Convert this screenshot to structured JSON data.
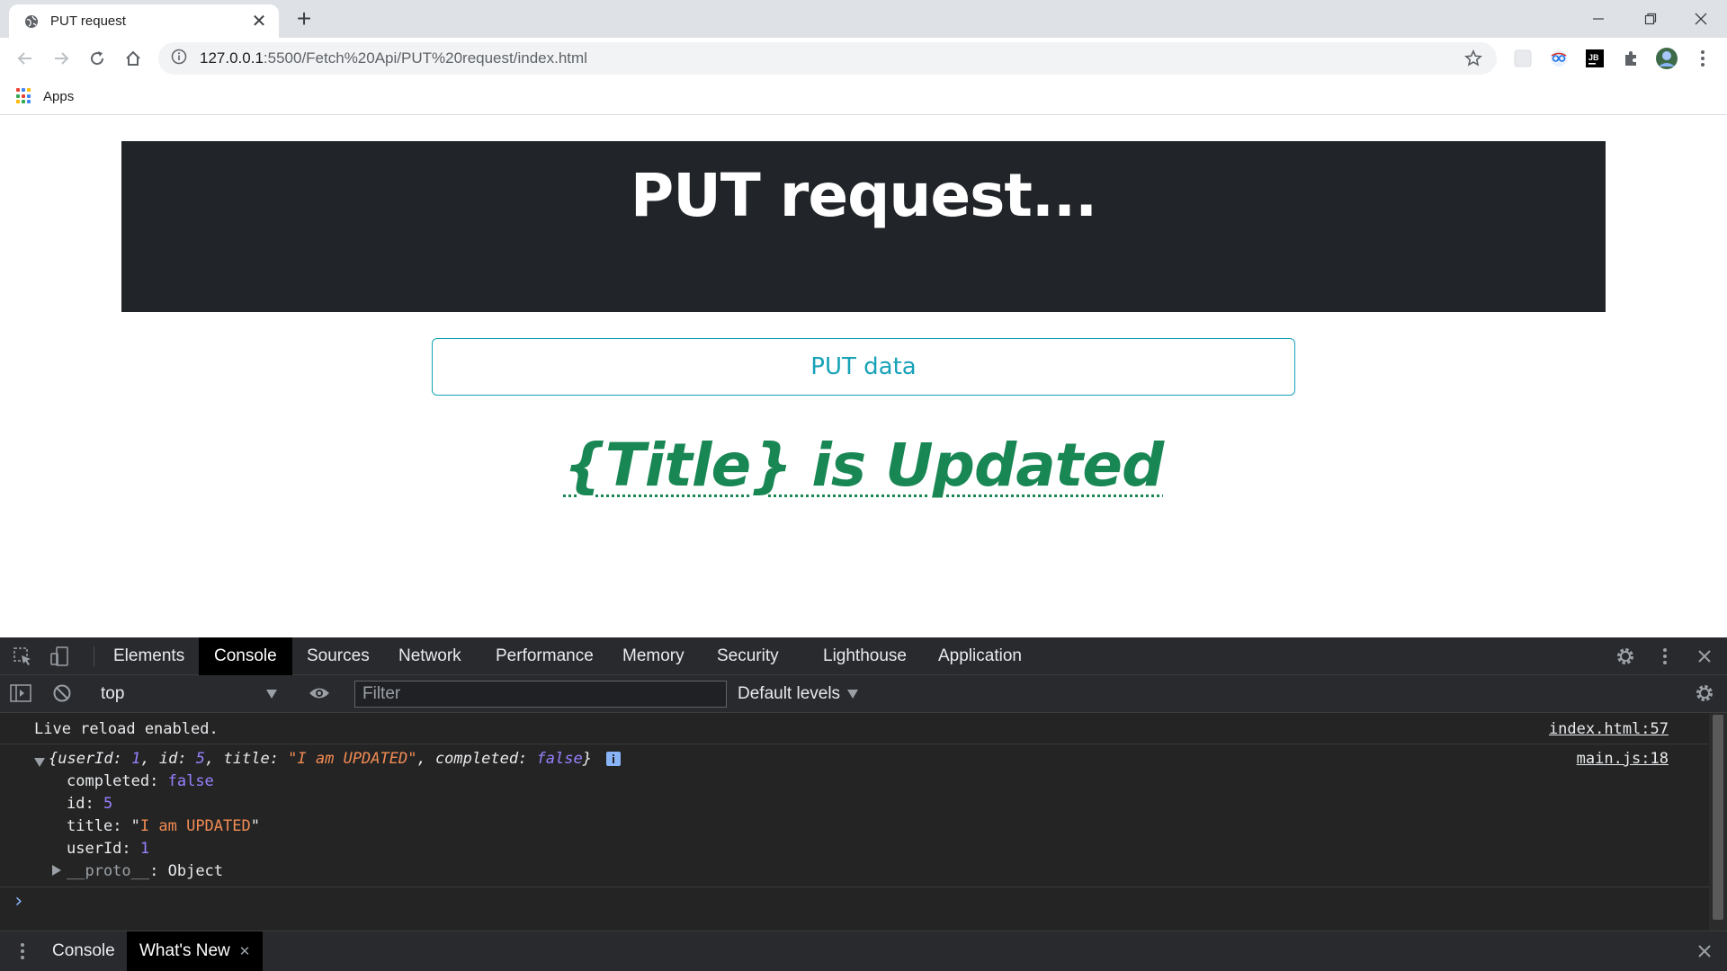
{
  "browser": {
    "tab_title": "PUT request",
    "tab_close": "✕",
    "new_tab": "+",
    "url_host": "127.0.0.1",
    "url_rest": ":5500/Fetch%20Api/PUT%20request/index.html",
    "bookmark_apps": "Apps"
  },
  "page": {
    "heading": "PUT request...",
    "button_label": "PUT data",
    "status_text": "{Title} is Updated"
  },
  "devtools": {
    "tabs": [
      "Elements",
      "Console",
      "Sources",
      "Network",
      "Performance",
      "Memory",
      "Security",
      "Lighthouse",
      "Application"
    ],
    "active_tab": "Console",
    "context": "top",
    "filter_placeholder": "Filter",
    "levels": "Default levels",
    "console": {
      "live_reload": "Live reload enabled.",
      "live_reload_source": "index.html:57",
      "log_source": "main.js:18",
      "summary": {
        "open": "{userId: ",
        "userId": "1",
        "id_label": ", id: ",
        "id": "5",
        "title_label": ", title: ",
        "title": "\"I am UPDATED\"",
        "completed_label": ", completed: ",
        "completed": "false",
        "close": "}"
      },
      "props": [
        {
          "key": "completed",
          "value": "false",
          "type": "kw"
        },
        {
          "key": "id",
          "value": "5",
          "type": "num"
        },
        {
          "key": "title",
          "value": "I am UPDATED",
          "type": "str"
        },
        {
          "key": "userId",
          "value": "1",
          "type": "num"
        }
      ],
      "proto_key": "__proto__",
      "proto_value": "Object",
      "prompt": "›"
    },
    "drawer_tabs": [
      "Console",
      "What's New"
    ],
    "drawer_close": "✕"
  },
  "colors": {
    "hero_bg": "#212529",
    "button_accent": "#17a2b8",
    "status_green": "#198754",
    "devtools_bg": "#242424"
  }
}
